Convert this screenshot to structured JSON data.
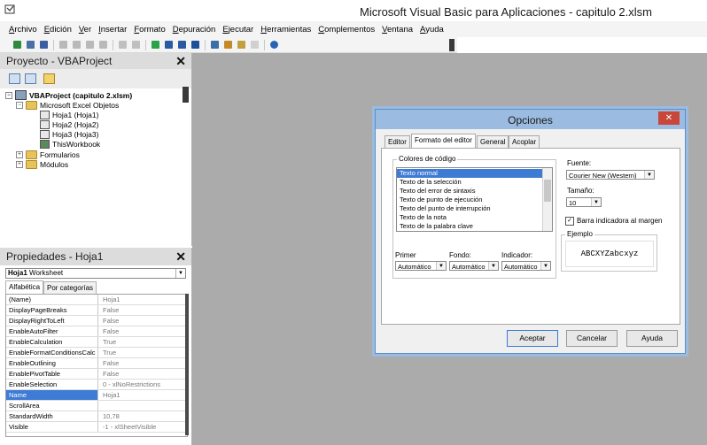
{
  "window": {
    "title": "Microsoft Visual Basic para Aplicaciones - capitulo 2.xlsm"
  },
  "menu": [
    "Archivo",
    "Edición",
    "Ver",
    "Insertar",
    "Formato",
    "Depuración",
    "Ejecutar",
    "Herramientas",
    "Complementos",
    "Ventana",
    "Ayuda"
  ],
  "project_panel": {
    "title": "Proyecto - VBAProject",
    "close_glyph": "✕",
    "tree": {
      "root": "VBAProject (capitulo 2.xlsm)",
      "excel_objects": "Microsoft Excel Objetos",
      "sheets": [
        "Hoja1 (Hoja1)",
        "Hoja2 (Hoja2)",
        "Hoja3 (Hoja3)",
        "ThisWorkbook"
      ],
      "forms": "Formularios",
      "modules": "Módulos"
    }
  },
  "properties_panel": {
    "title": "Propiedades - Hoja1",
    "close_glyph": "✕",
    "object_name": "Hoja1",
    "object_type": "Worksheet",
    "tabs": [
      "Alfabética",
      "Por categorías"
    ],
    "rows": [
      {
        "name": "(Name)",
        "value": "Hoja1"
      },
      {
        "name": "DisplayPageBreaks",
        "value": "False"
      },
      {
        "name": "DisplayRightToLeft",
        "value": "False"
      },
      {
        "name": "EnableAutoFilter",
        "value": "False"
      },
      {
        "name": "EnableCalculation",
        "value": "True"
      },
      {
        "name": "EnableFormatConditionsCalc",
        "value": "True"
      },
      {
        "name": "EnableOutlining",
        "value": "False"
      },
      {
        "name": "EnablePivotTable",
        "value": "False"
      },
      {
        "name": "EnableSelection",
        "value": "0 - xlNoRestrictions"
      },
      {
        "name": "Name",
        "value": "Hoja1"
      },
      {
        "name": "ScrollArea",
        "value": ""
      },
      {
        "name": "StandardWidth",
        "value": "10,78"
      },
      {
        "name": "Visible",
        "value": "-1 - xlSheetVisible"
      }
    ],
    "selected_row": "Name"
  },
  "dialog": {
    "title": "Opciones",
    "close_glyph": "✕",
    "tabs": [
      "Editor",
      "Formato del editor",
      "General",
      "Acoplar"
    ],
    "active_tab": "Formato del editor",
    "code_colors_label": "Colores de código",
    "code_items": [
      "Texto normal",
      "Texto de la selección",
      "Texto del error de sintaxis",
      "Texto de punto de ejecución",
      "Texto del punto de interrupción",
      "Texto de la nota",
      "Texto de la palabra clave"
    ],
    "selected_code_item": "Texto normal",
    "font_label": "Fuente:",
    "font_value": "Courier New (Western)",
    "size_label": "Tamaño:",
    "size_value": "10",
    "margin_bar_label": "Barra indicadora al margen",
    "margin_bar_checked": true,
    "check_glyph": "✓",
    "example_label": "Ejemplo",
    "example_text": "ABCXYZabcxyz",
    "foreground_label": "Primer",
    "background_label": "Fondo:",
    "indicator_label": "Indicador:",
    "foreground_value": "Automático",
    "background_value": "Automático",
    "indicator_value": "Automático",
    "buttons": {
      "ok": "Aceptar",
      "cancel": "Cancelar",
      "help": "Ayuda"
    }
  },
  "colors": {
    "selection": "#3e7bd4",
    "workspace": "#ababab",
    "dialog_frame": "#9bbbe0",
    "close_red": "#c9473a"
  }
}
